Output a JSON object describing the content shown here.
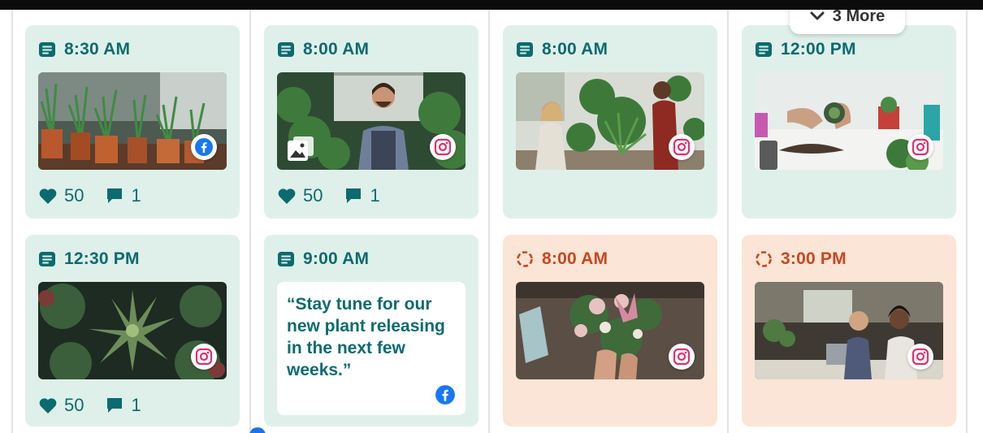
{
  "more_button": {
    "label": "3 More",
    "icon": "chevron-down-icon"
  },
  "posts": [
    {
      "time": "8:30 AM",
      "status": "published",
      "image": "potted-plants",
      "network": "facebook",
      "likes": "50",
      "comments": "1"
    },
    {
      "time": "8:00 AM",
      "status": "published",
      "image": "shop-owner",
      "network": "instagram",
      "gallery": true,
      "likes": "50",
      "comments": "1"
    },
    {
      "time": "8:00 AM",
      "status": "published",
      "image": "greenhouse-workers",
      "network": "instagram"
    },
    {
      "time": "12:00 PM",
      "status": "published",
      "image": "succulent-hands",
      "network": "instagram"
    },
    {
      "time": "12:30 PM",
      "status": "published",
      "image": "succulent-closeup",
      "network": "instagram",
      "likes": "50",
      "comments": "1"
    },
    {
      "time": "9:00 AM",
      "status": "published",
      "text": "“Stay tune for our new plant releasing in the next few weeks.”",
      "network": "facebook"
    },
    {
      "time": "8:00 AM",
      "status": "pending",
      "image": "flower-bouquet",
      "network": "instagram"
    },
    {
      "time": "3:00 PM",
      "status": "pending",
      "image": "laptop-meeting",
      "network": "instagram"
    }
  ],
  "colors": {
    "published_bg": "#dff0ea",
    "pending_bg": "#fbe5d6",
    "published_text": "#0b6b6f",
    "pending_text": "#c9461f",
    "facebook": "#1877f2",
    "instagram": "#e1306c"
  }
}
